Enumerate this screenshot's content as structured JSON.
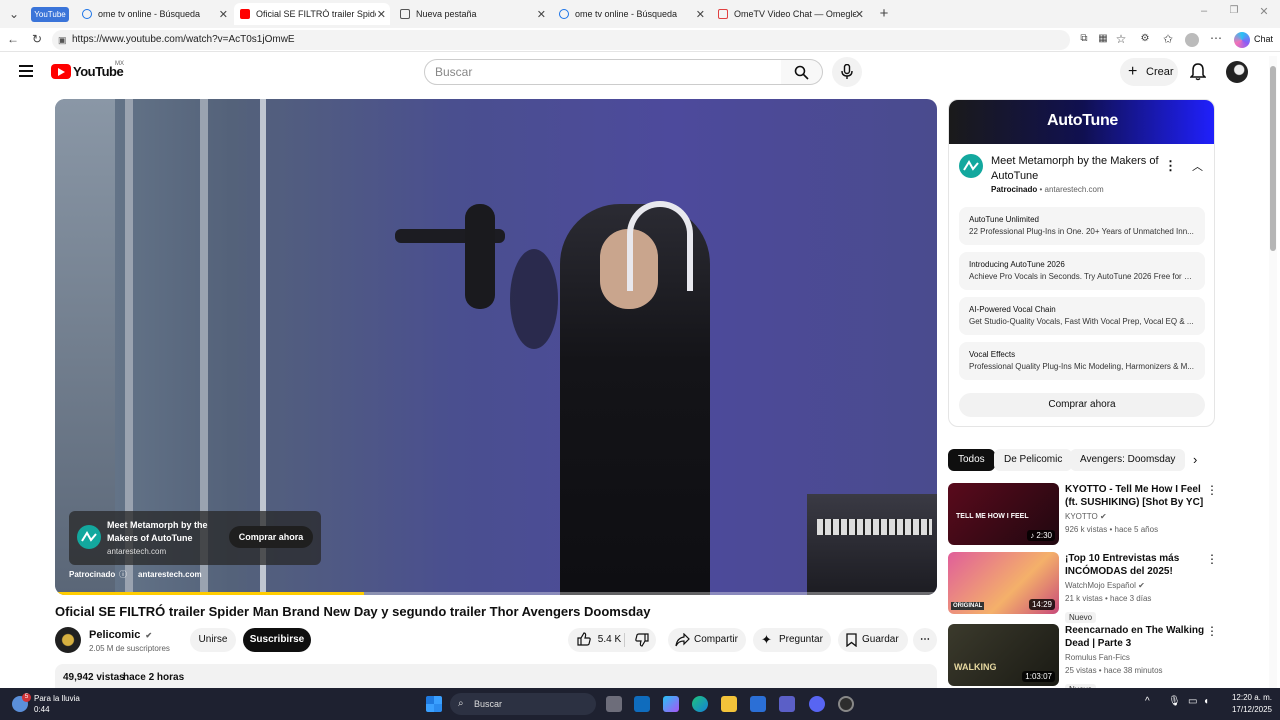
{
  "browser": {
    "tabs": [
      {
        "label": "YouTube",
        "kind": "group"
      },
      {
        "label": "ome tv online - Búsqueda"
      },
      {
        "label": "Oficial SE FILTRÓ trailer Spider Ma",
        "active": true
      },
      {
        "label": "Nueva pestaña"
      },
      {
        "label": "ome tv online - Búsqueda"
      },
      {
        "label": "OmeTV Video Chat — Omegle Ra"
      }
    ],
    "url": "https://www.youtube.com/watch?v=AcT0s1jOmwE",
    "chat_label": "Chat"
  },
  "header": {
    "logo_text": "YouTube",
    "region": "MX",
    "search_placeholder": "Buscar",
    "create_label": "Crear"
  },
  "video": {
    "overlay_title": "Meet Metamorph by the Makers of AutoTune",
    "overlay_domain": "antarestech.com",
    "overlay_cta": "Comprar ahora",
    "sponsored": "Patrocinado",
    "sponsored_domain": "antarestech.com",
    "progress": 0.35,
    "title": "Oficial SE FILTRÓ trailer Spider Man Brand New Day y segundo trailer Thor Avengers Doomsday"
  },
  "channel": {
    "name": "Pelicomic",
    "subs": "2.05 M de suscriptores",
    "join": "Unirse",
    "subscribe": "Suscribirse"
  },
  "actions": {
    "likes": "5.4 K",
    "share": "Compartir",
    "ask": "Preguntar",
    "save": "Guardar"
  },
  "description": {
    "views": "49,942 vistas",
    "when": "hace 2 horas"
  },
  "ad": {
    "banner": "AutoTune",
    "title": "Meet Metamorph by the Makers of AutoTune",
    "sponsored": "Patrocinado",
    "domain": "antarestech.com",
    "sitelinks": [
      {
        "title": "AutoTune Unlimited",
        "desc": "22 Professional Plug-Ins in One. 20+ Years of Unmatched Inn..."
      },
      {
        "title": "Introducing AutoTune 2026",
        "desc": "Achieve Pro Vocals in Seconds. Try AutoTune 2026 Free for 1..."
      },
      {
        "title": "AI-Powered Vocal Chain",
        "desc": "Get Studio-Quality Vocals, Fast With Vocal Prep, Vocal EQ & ..."
      },
      {
        "title": "Vocal Effects",
        "desc": "Professional Quality Plug-Ins Mic Modeling, Harmonizers & M..."
      }
    ],
    "cta": "Comprar ahora"
  },
  "chips": [
    "Todos",
    "De Pelicomic",
    "Avengers: Doomsday"
  ],
  "recommendations": [
    {
      "title": "KYOTTO - Tell Me How I Feel (ft. SUSHIKING) [Shot By YC]",
      "channel": "KYOTTO",
      "meta": "926 k vistas • hace 5 años",
      "duration": "2:30",
      "thumb_text": "TELL ME HOW I FEEL"
    },
    {
      "title": "¡Top 10 Entrevistas más INCÓMODAS del 2025!",
      "channel": "WatchMojo Español",
      "meta": "21 k vistas • hace 3 días",
      "duration": "14:29",
      "badge": "Nuevo",
      "thumb_text": "ORIGINAL"
    },
    {
      "title": "Reencarnado en The Walking Dead | Parte 3",
      "channel": "Romulus Fan-Fics",
      "meta": "25 vistas • hace 38 minutos",
      "duration": "1:03:07",
      "badge": "Nuevo",
      "thumb_text": "WALKING"
    }
  ],
  "taskbar": {
    "weather_title": "Para la lluvia",
    "weather_sub": "0:44",
    "weather_badge": "5",
    "search": "Buscar",
    "time": "12:20 a. m.",
    "date": "17/12/2025"
  }
}
